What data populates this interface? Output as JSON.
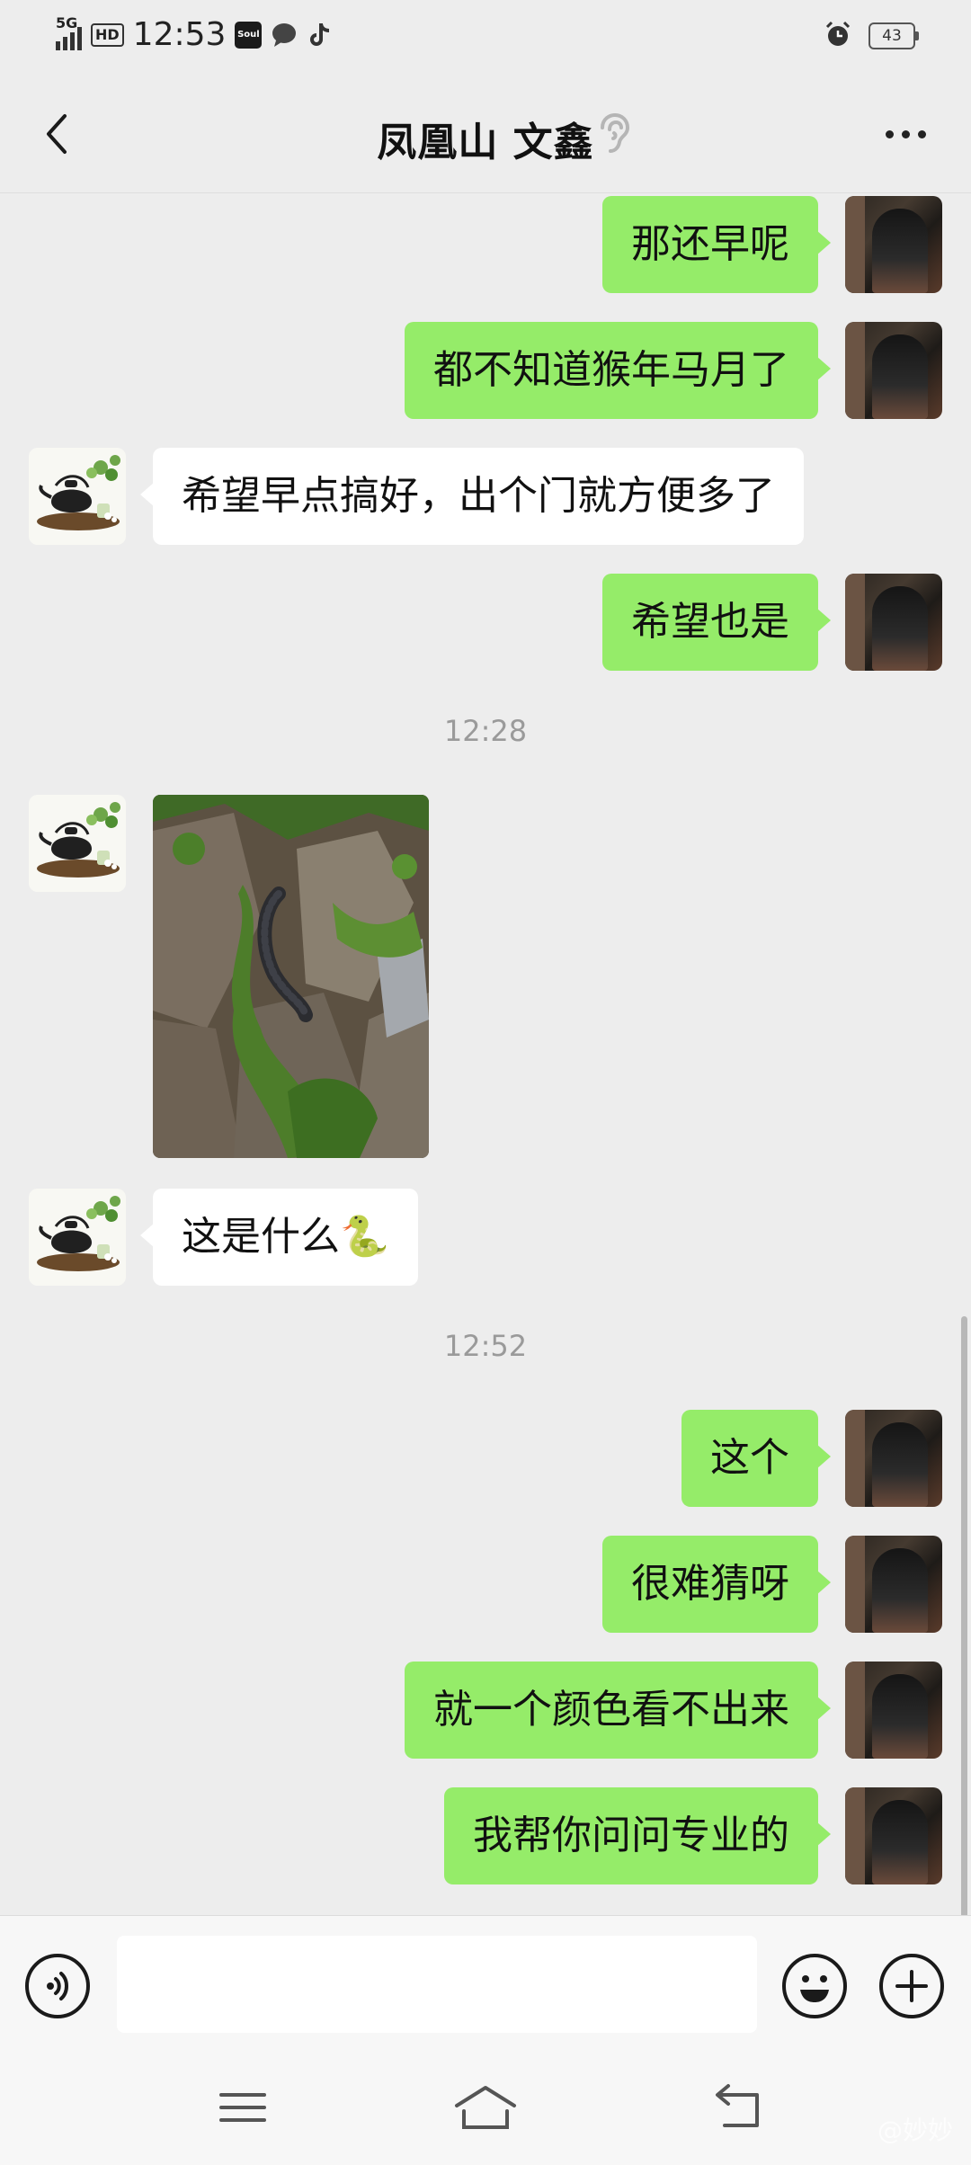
{
  "status_bar": {
    "network": "5G",
    "hd": "HD",
    "time": "12:53",
    "app_icons": [
      "soul-app-icon",
      "message-bubble-icon",
      "tiktok-icon"
    ],
    "soul_label": "Soul",
    "battery": "43"
  },
  "header": {
    "title": "凤凰山  文鑫",
    "icons": [
      "back-chevron-icon",
      "ear-icon",
      "more-dots-icon"
    ]
  },
  "messages": [
    {
      "sender": "me",
      "text": "那还早呢"
    },
    {
      "sender": "me",
      "text": "都不知道猴年马月了"
    },
    {
      "sender": "other",
      "text": "希望早点搞好，出个门就方便多了"
    },
    {
      "sender": "me",
      "text": "希望也是"
    },
    {
      "type": "time",
      "text": "12:28"
    },
    {
      "sender": "other",
      "type": "image",
      "icon": "mossy-rocks-snake-photo"
    },
    {
      "sender": "other",
      "text": "这是什么🐍"
    },
    {
      "type": "time",
      "text": "12:52"
    },
    {
      "sender": "me",
      "text": "这个"
    },
    {
      "sender": "me",
      "text": "很难猜呀"
    },
    {
      "sender": "me",
      "text": "就一个颜色看不出来"
    },
    {
      "sender": "me",
      "text": "我帮你问问专业的"
    }
  ],
  "input_bar": {
    "voice_icon": "voice-icon",
    "emoji_icon": "emoji-icon",
    "add_icon": "plus-icon",
    "value": ""
  },
  "nav_bar": {
    "icons": [
      "menu-icon",
      "home-icon",
      "back-icon"
    ],
    "watermark": "@妙妙"
  },
  "colors": {
    "bubble_me": "#95ec69",
    "bubble_other": "#ffffff",
    "background": "#ededed"
  }
}
